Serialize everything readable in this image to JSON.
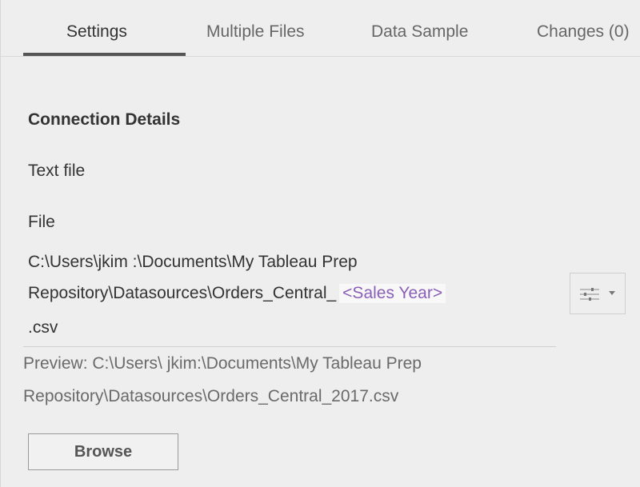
{
  "tabs": [
    {
      "label": "Settings",
      "active": true
    },
    {
      "label": "Multiple Files",
      "active": false
    },
    {
      "label": "Data Sample",
      "active": false
    },
    {
      "label": "Changes (0)",
      "active": false
    }
  ],
  "connection": {
    "section_title": "Connection Details",
    "type": "Text file",
    "file_label": "File",
    "path_line1": "C:\\Users\\jkim :\\Documents\\My Tableau Prep",
    "path_line2_prefix": "Repository\\Datasources\\Orders_Central_",
    "path_param": "<Sales Year>",
    "path_line3": ".csv",
    "options_icon": "sliders-icon"
  },
  "preview": {
    "line1": "Preview: C:\\Users\\ jkim:\\Documents\\My Tableau Prep",
    "line2": "Repository\\Datasources\\Orders_Central_2017.csv"
  },
  "browse_label": "Browse",
  "colors": {
    "background": "#eeeeee",
    "param_text": "#8a5fb8",
    "tab_underline": "#555555"
  }
}
